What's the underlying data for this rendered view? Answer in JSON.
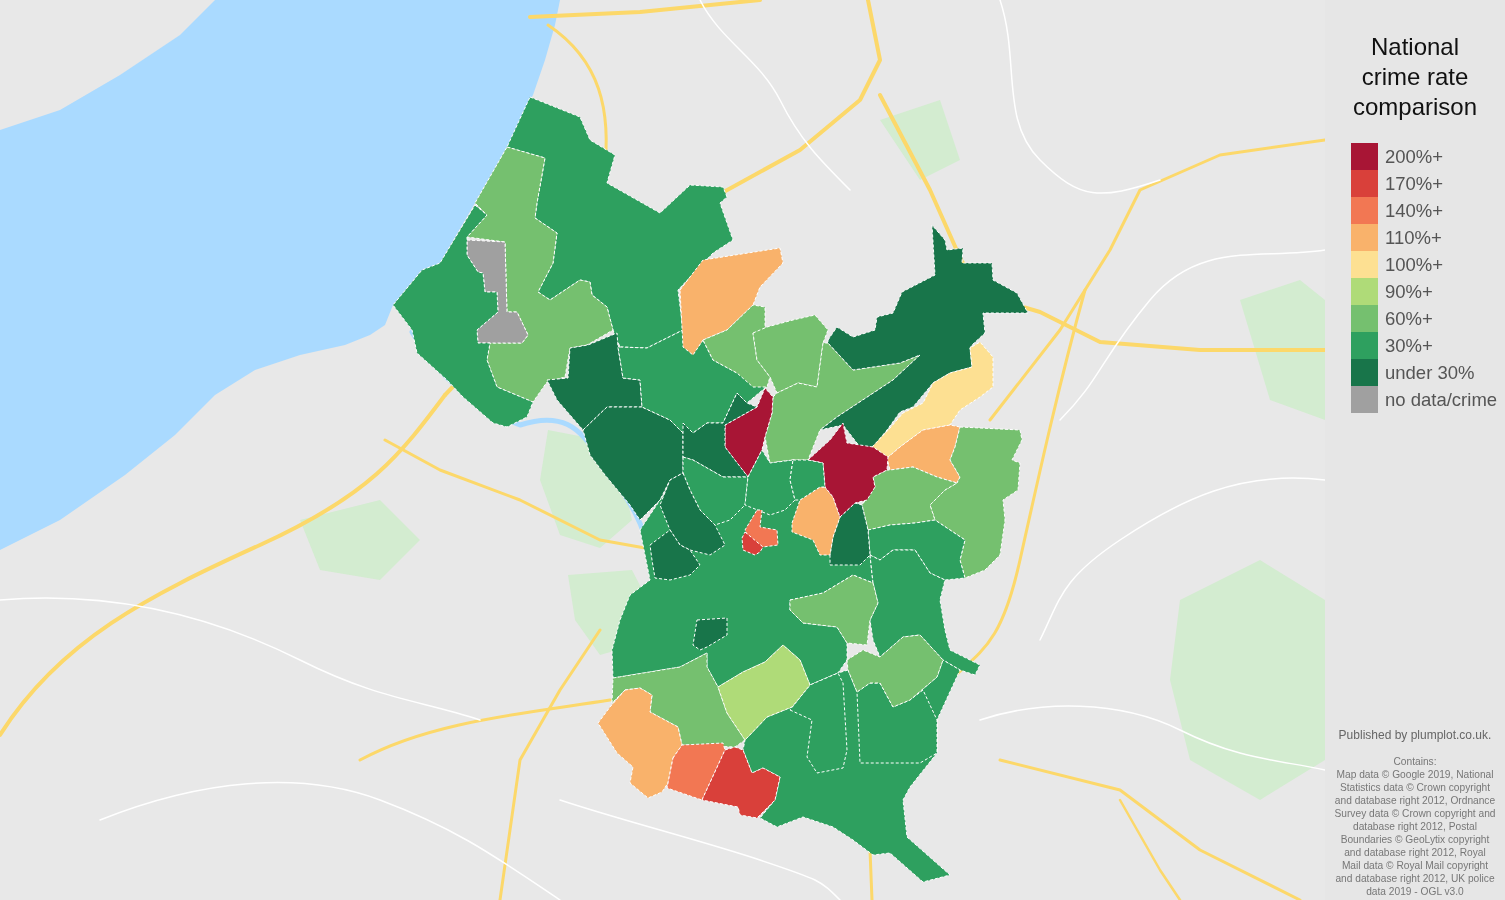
{
  "map": {
    "districts": [
      {
        "color": "#2ea05f"
      },
      {
        "color": "#75c06f"
      },
      {
        "color": "#a0a0a0"
      },
      {
        "color": "#2ea05f"
      },
      {
        "color": "#18754a"
      },
      {
        "color": "#18754a"
      },
      {
        "color": "#2ea05f"
      },
      {
        "color": "#f9b26b"
      },
      {
        "color": "#75c06f"
      },
      {
        "color": "#75c06f"
      },
      {
        "color": "#75c06f"
      },
      {
        "color": "#18754a"
      },
      {
        "color": "#fde092"
      },
      {
        "color": "#f9b26b"
      },
      {
        "color": "#75c06f"
      },
      {
        "color": "#75c06f"
      },
      {
        "color": "#2ea05f"
      },
      {
        "color": "#2ea05f"
      },
      {
        "color": "#18754a"
      },
      {
        "color": "#f9b26b"
      },
      {
        "color": "#a81535"
      },
      {
        "color": "#a81535"
      },
      {
        "color": "#18754a"
      },
      {
        "color": "#2ea05f"
      },
      {
        "color": "#2ea05f"
      },
      {
        "color": "#2ea05f"
      },
      {
        "color": "#f27753"
      },
      {
        "color": "#d9403a"
      },
      {
        "color": "#18754a"
      },
      {
        "color": "#18754a"
      },
      {
        "color": "#2ea05f"
      },
      {
        "color": "#2ea05f"
      },
      {
        "color": "#2ea05f"
      },
      {
        "color": "#2ea05f"
      },
      {
        "color": "#75c06f"
      },
      {
        "color": "#75c06f"
      },
      {
        "color": "#18754a"
      },
      {
        "color": "#75c06f"
      },
      {
        "color": "#f9b26b"
      },
      {
        "color": "#f27753"
      },
      {
        "color": "#d9403a"
      },
      {
        "color": "#afdb78"
      }
    ]
  },
  "legend": {
    "title": "National crime rate comparison",
    "items": [
      {
        "label": "200%+",
        "color": "#a81535"
      },
      {
        "label": "170%+",
        "color": "#d9403a"
      },
      {
        "label": "140%+",
        "color": "#f27753"
      },
      {
        "label": "110%+",
        "color": "#f9b26b"
      },
      {
        "label": "100%+",
        "color": "#fde092"
      },
      {
        "label": "90%+",
        "color": "#afdb78"
      },
      {
        "label": "60%+",
        "color": "#75c06f"
      },
      {
        "label": "30%+",
        "color": "#2ea05f"
      },
      {
        "label": "under 30%",
        "color": "#18754a"
      },
      {
        "label": "no data/crime",
        "color": "#a0a0a0"
      }
    ]
  },
  "attribution": {
    "publisher": "Published by plumplot.co.uk.",
    "contains_label": "Contains:",
    "credits": "Map data © Google 2019, National Statistics data © Crown copyright and database right 2012, Ordnance Survey data © Crown copyright and database right 2012, Postal Boundaries © GeoLytix copyright and database right 2012, Royal Mail data © Royal Mail copyright and database right 2012, UK police data 2019 - OGL v3.0"
  }
}
